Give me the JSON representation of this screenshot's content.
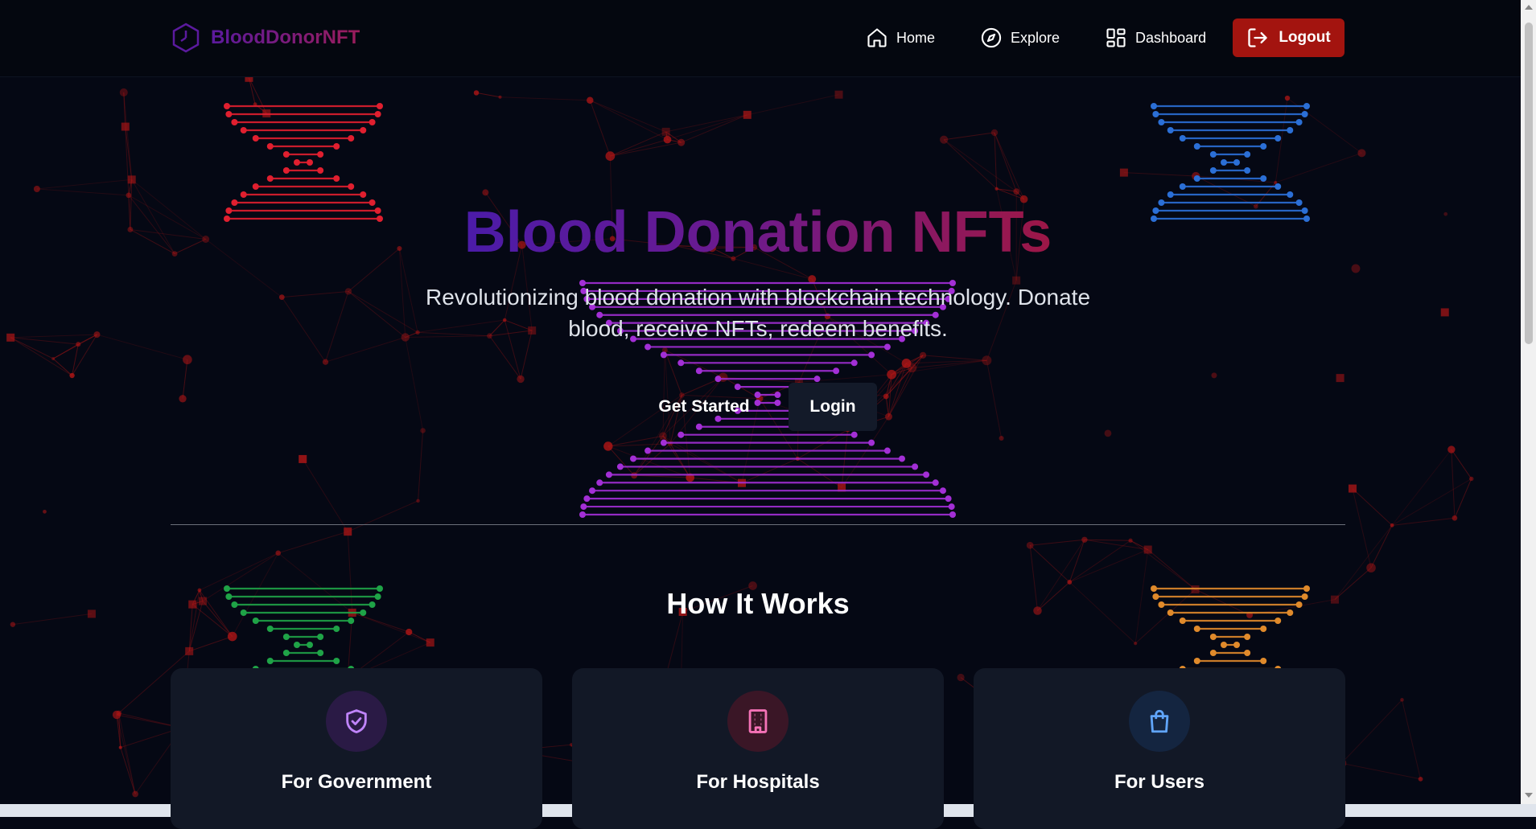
{
  "nav": {
    "brand": "BloodDonorNFT",
    "links": [
      {
        "label": "Home",
        "icon": "home-icon"
      },
      {
        "label": "Explore",
        "icon": "compass-icon"
      },
      {
        "label": "Dashboard",
        "icon": "dashboard-icon"
      }
    ],
    "logout_label": "Logout"
  },
  "hero": {
    "title": "Blood Donation NFTs",
    "subtitle": "Revolutionizing blood donation with blockchain technology. Donate blood, receive NFTs, redeem benefits.",
    "get_started_label": "Get Started",
    "login_label": "Login"
  },
  "how": {
    "title": "How It Works",
    "cards": [
      {
        "title": "For Government",
        "icon": "shield-check-icon",
        "accent": "#a855f7"
      },
      {
        "title": "For Hospitals",
        "icon": "building-icon",
        "accent": "#f472b6"
      },
      {
        "title": "For Users",
        "icon": "shopping-bag-icon",
        "accent": "#60a5fa"
      }
    ]
  },
  "colors": {
    "background": "#050814",
    "network": "#b01616",
    "logout": "#a3140f",
    "helix_red": "#e01f2f",
    "helix_blue": "#2b6fd6",
    "helix_purple": "#a32fd6",
    "helix_green": "#1fa347",
    "helix_orange": "#e08a2b"
  }
}
